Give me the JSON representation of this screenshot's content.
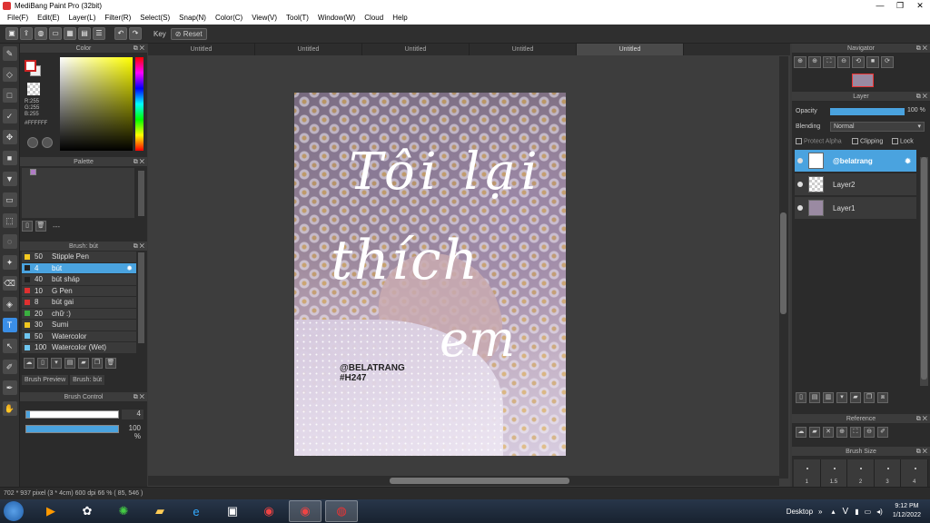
{
  "window": {
    "title": "MediBang Paint Pro (32bit)"
  },
  "menu": [
    "File(F)",
    "Edit(E)",
    "Layer(L)",
    "Filter(R)",
    "Select(S)",
    "Snap(N)",
    "Color(C)",
    "View(V)",
    "Tool(T)",
    "Window(W)",
    "Cloud",
    "Help"
  ],
  "toolbar": {
    "key_label": "Key",
    "reset_label": "Reset"
  },
  "color_panel": {
    "title": "Color",
    "r": "R:255",
    "g": "G:255",
    "b": "B:255",
    "hex": "#FFFFFF",
    "fg_color": "#ffffff"
  },
  "palette_panel": {
    "title": "Palette",
    "swatch_color": "#b07cc6",
    "dash": "---"
  },
  "brush_panel": {
    "title": "Brush: bút",
    "items": [
      {
        "size": "50",
        "name": "Stipple Pen",
        "color": "#f2c820"
      },
      {
        "size": "4",
        "name": "bút",
        "color": "#222222",
        "selected": true
      },
      {
        "size": "40",
        "name": "bút sháp",
        "color": "#222222"
      },
      {
        "size": "10",
        "name": "G Pen",
        "color": "#e03030"
      },
      {
        "size": "8",
        "name": "bút gai",
        "color": "#e03030"
      },
      {
        "size": "20",
        "name": "chữ :)",
        "color": "#3ab040"
      },
      {
        "size": "30",
        "name": "Sumi",
        "color": "#f2c820"
      },
      {
        "size": "50",
        "name": "Watercolor",
        "color": "#6ec6f0"
      },
      {
        "size": "100",
        "name": "Watercolor (Wet)",
        "color": "#6ec6f0"
      }
    ],
    "tab_preview": "Brush Preview",
    "tab_brush": "Brush: bút"
  },
  "brush_control": {
    "title": "Brush Control",
    "size": "4",
    "size_fraction": 0.04,
    "opacity": "100 %",
    "opacity_fraction": 1.0
  },
  "doc_tabs": [
    "Untitled",
    "Untitled",
    "Untitled",
    "Untitled",
    "Untitled"
  ],
  "artwork": {
    "line1": "Tôi lại",
    "line2": "thích",
    "line3": "em",
    "watermark1": "@BELATRANG",
    "watermark2": "#H247"
  },
  "navigator": {
    "title": "Navigator"
  },
  "layer_panel": {
    "title": "Layer",
    "opacity_label": "Opacity",
    "opacity_value": "100 %",
    "opacity_fraction": 1.0,
    "blending_label": "Blending",
    "blending_value": "Normal",
    "protect_alpha": "Protect Alpha",
    "clipping": "Clipping",
    "lock": "Lock",
    "layers": [
      {
        "name": "@belatrang",
        "selected": true
      },
      {
        "name": "Layer2"
      },
      {
        "name": "Layer1"
      }
    ]
  },
  "reference": {
    "title": "Reference"
  },
  "brush_size": {
    "title": "Brush Size",
    "sizes": [
      "1",
      "1.5",
      "2",
      "3",
      "4"
    ]
  },
  "status": {
    "text": "702 * 937 pixel  (3 * 4cm)  600 dpi  66 %  ( 85, 546 )"
  },
  "taskbar": {
    "desktop": "Desktop",
    "time": "9:12 PM",
    "date": "1/12/2022",
    "lang": "V"
  }
}
